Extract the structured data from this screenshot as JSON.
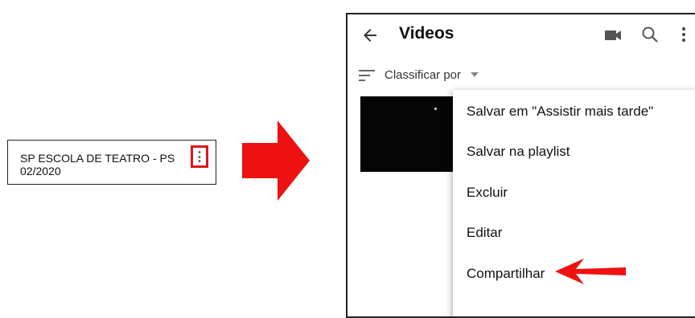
{
  "card": {
    "title": "SP ESCOLA DE TEATRO - PS 02/2020",
    "more_icon": "kebab-vertical-icon",
    "highlight_color": "#e0141a"
  },
  "annotation": {
    "arrow_color": "#ee1111",
    "arrow_icon": "right-arrow-icon",
    "pointer_icon": "left-arrow-icon"
  },
  "appbar": {
    "title": "Videos",
    "back_icon": "arrow-back-icon",
    "camera_icon": "video-camera-icon",
    "search_icon": "search-icon",
    "more_icon": "kebab-vertical-icon"
  },
  "sort": {
    "label": "Classificar por",
    "icon": "sort-icon",
    "caret_icon": "caret-down-icon"
  },
  "menu": {
    "items": [
      {
        "label": "Salvar em \"Assistir mais tarde\""
      },
      {
        "label": "Salvar na playlist"
      },
      {
        "label": "Excluir"
      },
      {
        "label": "Editar"
      },
      {
        "label": "Compartilhar"
      }
    ]
  }
}
